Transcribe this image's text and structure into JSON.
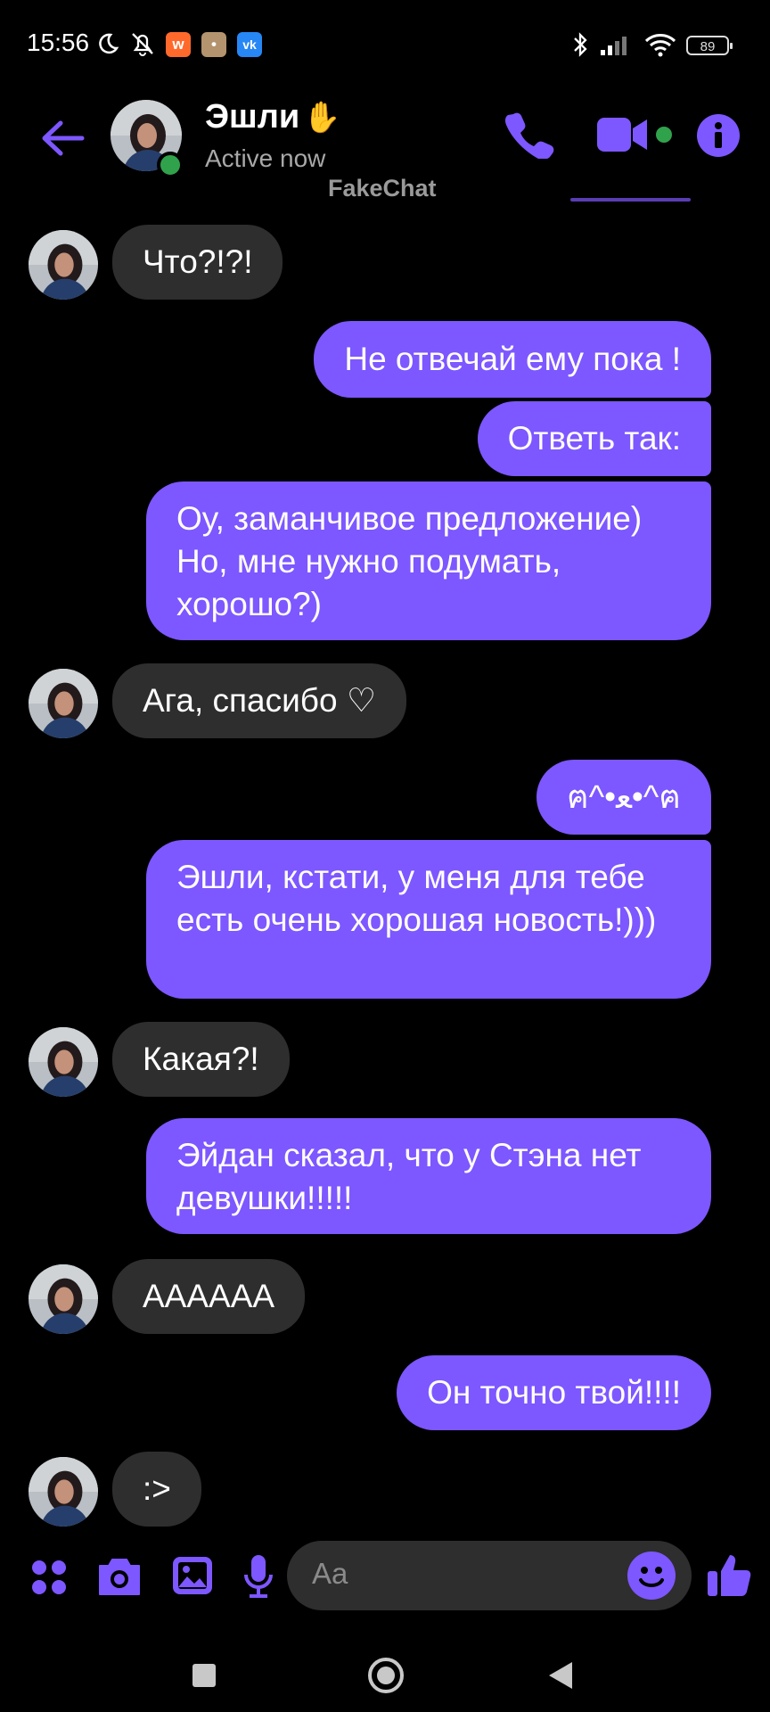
{
  "status_bar": {
    "time": "15:56",
    "battery": "89"
  },
  "header": {
    "contact_name": "Эшли",
    "name_emoji": "✋",
    "status": "Active now",
    "watermark": "FakeChat"
  },
  "messages": [
    {
      "from": "them",
      "text": "Что?!?!"
    },
    {
      "from": "me",
      "text": "Не отвечай ему пока !"
    },
    {
      "from": "me",
      "text": "Ответь так:"
    },
    {
      "from": "me",
      "text": "Оу, заманчивое предложение) Но, мне нужно подумать, хорошо?)"
    },
    {
      "from": "them",
      "text": "Ага, спасибо ♡"
    },
    {
      "from": "me",
      "text": "ฅ^•ﻌ•^ฅ"
    },
    {
      "from": "me",
      "text": "Эшли, кстати, у меня для тебе есть очень хорошая новость!)))"
    },
    {
      "from": "them",
      "text": "Какая?!"
    },
    {
      "from": "me",
      "text": "Эйдан сказал, что у Стэна нет девушки!!!!!"
    },
    {
      "from": "them",
      "text": "АААААА"
    },
    {
      "from": "me",
      "text": "Он точно твой!!!!"
    },
    {
      "from": "them",
      "text": ":>"
    }
  ],
  "composer": {
    "placeholder": "Aa"
  },
  "icons": {
    "back": "back-arrow-icon",
    "call": "phone-icon",
    "video": "video-camera-icon",
    "info": "info-icon",
    "apps": "apps-grid-icon",
    "camera": "camera-icon",
    "gallery": "image-icon",
    "mic": "microphone-icon",
    "emoji": "emoji-icon",
    "like": "thumbs-up-icon"
  },
  "colors": {
    "accent": "#7d57ff",
    "incoming_bubble": "#2e2e2e",
    "background": "#000000",
    "online": "#31a24c"
  }
}
